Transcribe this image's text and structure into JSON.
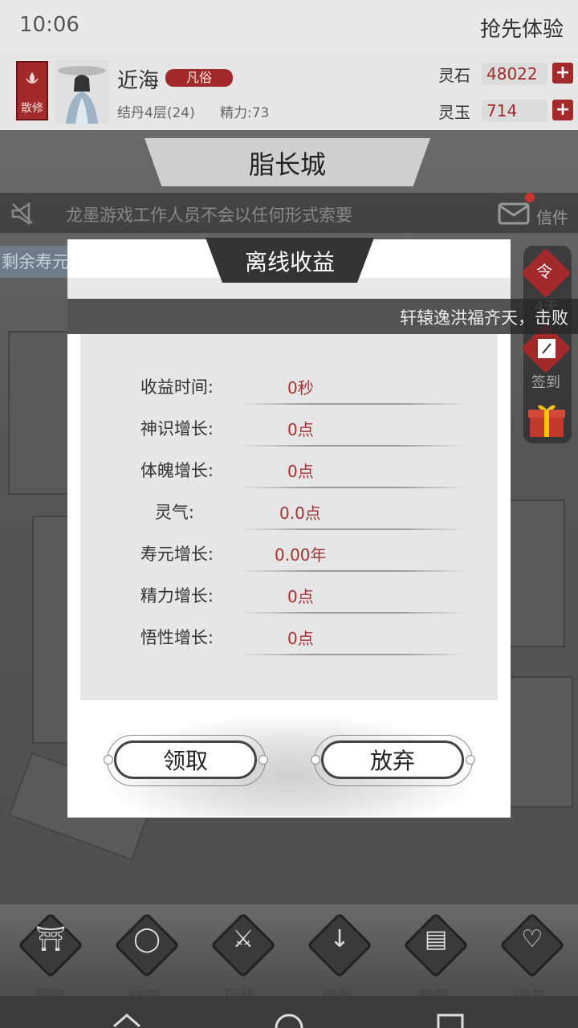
{
  "status_bar": {
    "time": "10:06",
    "right_label": "抢先体验"
  },
  "player": {
    "sect_badge": "散修",
    "name": "近海",
    "rank": "凡俗",
    "realm": "结丹4层(24)",
    "energy": "精力:73"
  },
  "resources": [
    {
      "label": "灵石",
      "value": "48022"
    },
    {
      "label": "灵玉",
      "value": "714"
    }
  ],
  "scene": {
    "city_name": "脂长城",
    "notice": "龙墨游戏工作人员不会以任何形式索要",
    "mail_label": "信件",
    "left_strip_text": "剩余寿元",
    "side_icons": [
      {
        "name": "order",
        "label": "4天"
      },
      {
        "name": "sign-in",
        "label": "签到"
      },
      {
        "name": "gift",
        "label": ""
      }
    ]
  },
  "modal": {
    "title": "离线收益",
    "marquee": "轩辕逸洪福齐天，击败",
    "rows": [
      {
        "label": "收益时间:",
        "value": "0秒"
      },
      {
        "label": "神识增长:",
        "value": "0点"
      },
      {
        "label": "体魄增长:",
        "value": "0点"
      },
      {
        "label": "灵气:",
        "value": "0.0点"
      },
      {
        "label": "寿元增长:",
        "value": "0.00年"
      },
      {
        "label": "精力增长:",
        "value": "0点"
      },
      {
        "label": "悟性增长:",
        "value": "0点"
      }
    ],
    "claim_label": "领取",
    "abandon_label": "放弃"
  },
  "bottom_nav": [
    {
      "label": "洞府",
      "icon": "cave-icon"
    },
    {
      "label": "纳戒",
      "icon": "ring-icon"
    },
    {
      "label": "历练",
      "icon": "crossed-swords-icon"
    },
    {
      "label": "装备",
      "icon": "sword-icon"
    },
    {
      "label": "参悟",
      "icon": "book-icon"
    },
    {
      "label": "道友",
      "icon": "handshake-icon"
    }
  ]
}
